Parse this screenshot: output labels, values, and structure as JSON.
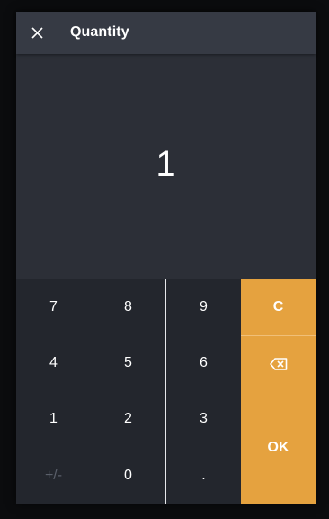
{
  "dialog": {
    "title": "Quantity",
    "close_icon": "close-icon"
  },
  "display": {
    "value": "1"
  },
  "keypad": {
    "rows": [
      [
        "7",
        "8",
        "9"
      ],
      [
        "4",
        "5",
        "6"
      ],
      [
        "1",
        "2",
        "3"
      ],
      [
        "+/-",
        "0",
        "."
      ]
    ],
    "disabled_keys": [
      "+/-"
    ]
  },
  "actions": {
    "clear_label": "C",
    "backspace_icon": "backspace-icon",
    "ok_label": "OK"
  },
  "colors": {
    "accent": "#e5a23f",
    "background": "#2c2f37",
    "header": "#363a44",
    "keypad": "#23262d"
  }
}
